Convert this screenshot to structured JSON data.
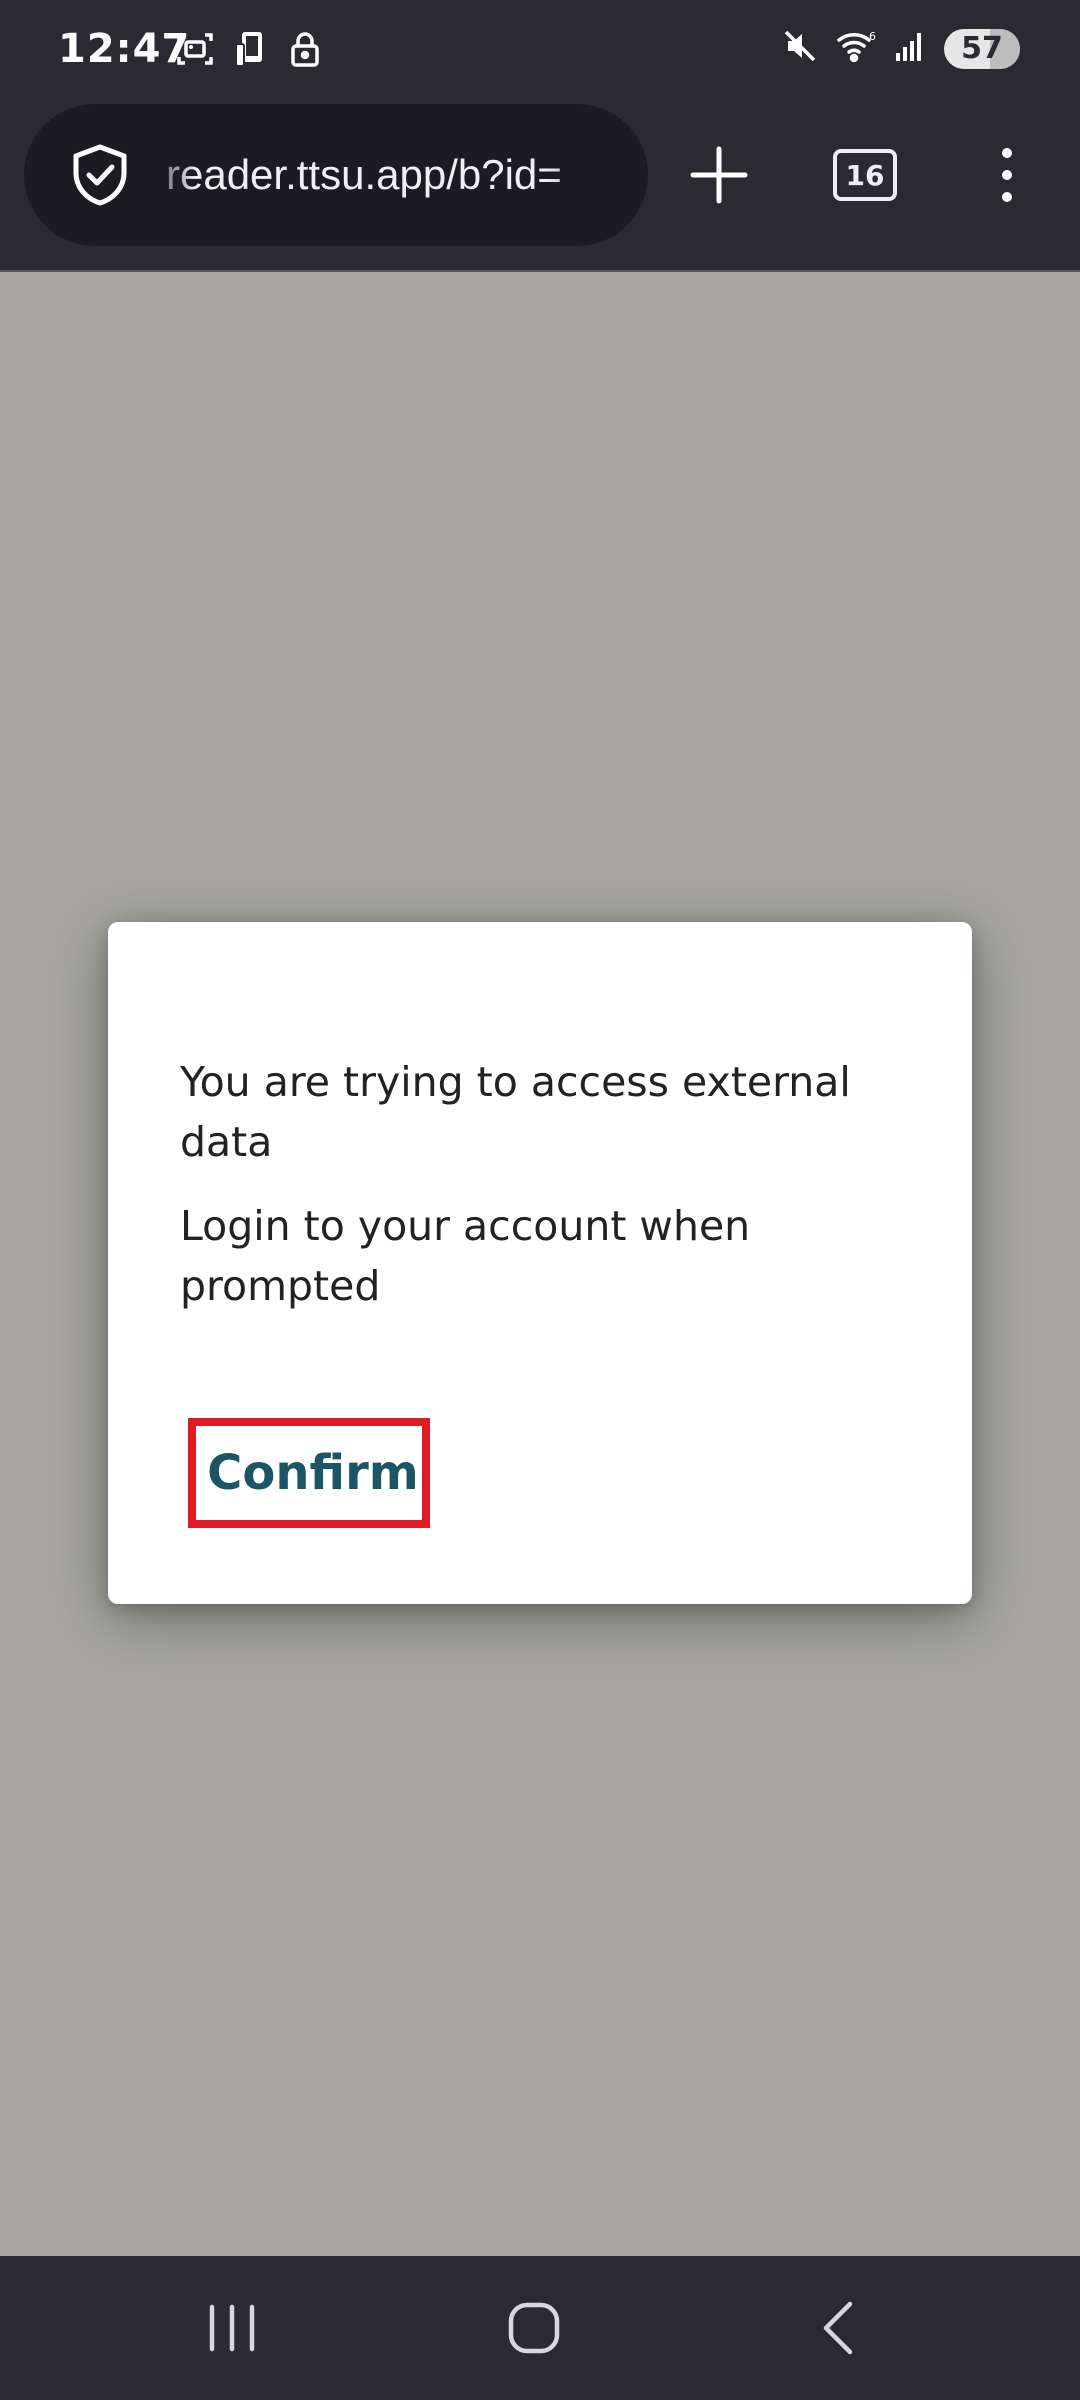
{
  "status_bar": {
    "time": "12:47",
    "left_icons": [
      "screenshot-icon",
      "device-icon",
      "lock-icon"
    ],
    "right_icons": [
      "mute-icon",
      "wifi-icon",
      "signal-icon"
    ],
    "battery": "57"
  },
  "browser": {
    "url": "reader.ttsu.app/b?id=",
    "tab_count": "16",
    "icons": [
      "shield-check-icon",
      "plus-icon",
      "tabs-icon",
      "more-vert-icon"
    ]
  },
  "dialog": {
    "message_1": "You are trying to access external data",
    "message_2": "Login to your account when prompted",
    "confirm_label": "Confirm"
  },
  "nav_bar": {
    "icons": [
      "recents-icon",
      "home-icon",
      "back-icon"
    ]
  },
  "colors": {
    "page_background": "#a7a7a0",
    "toolbar": "#2b2a33",
    "url_bar": "#1c1b22",
    "confirm_text": "#1d5566",
    "highlight_border": "#e01b24"
  }
}
